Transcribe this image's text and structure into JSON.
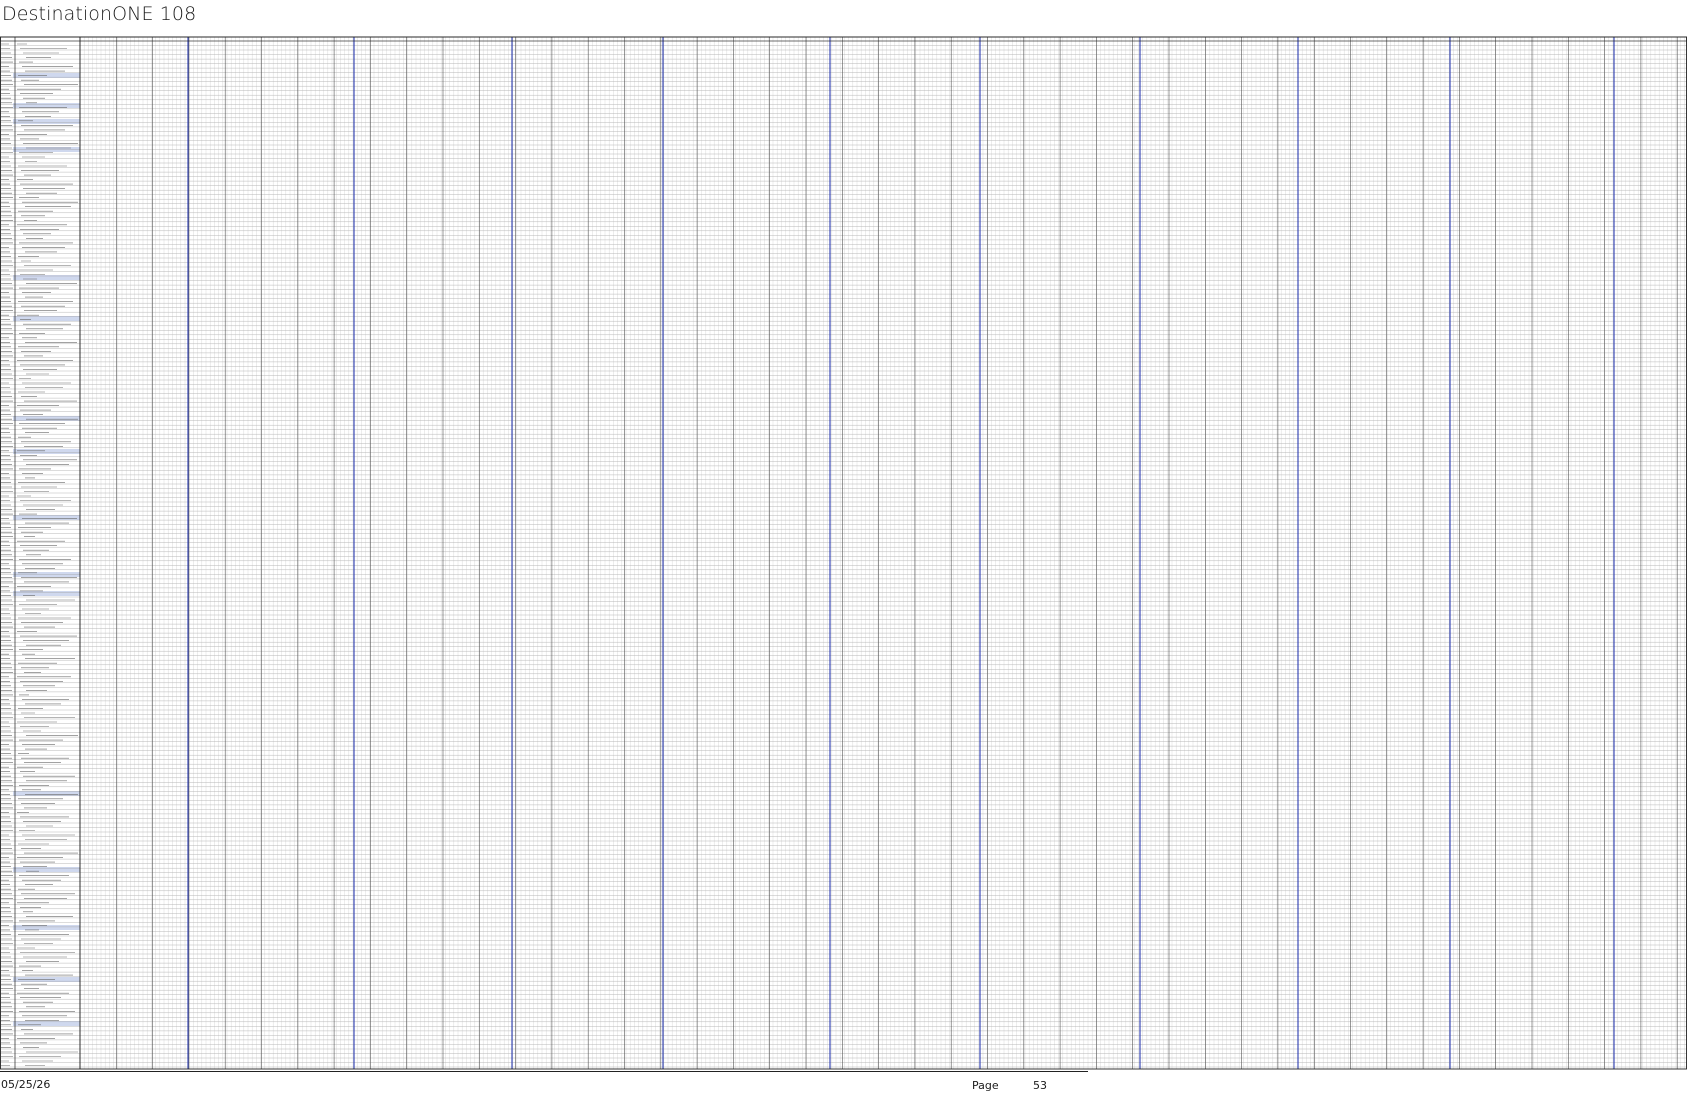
{
  "document": {
    "title": "DestinationONE 108"
  },
  "footer": {
    "date": "05/25/26",
    "page_label": "Page",
    "page_number": "53"
  },
  "colors": {
    "text": "#1a1a1a",
    "grid_line": "#9a9a9a",
    "divider_blue": "#2a3bb0",
    "row_highlight": "#cfd8ee",
    "frame": "#222222"
  }
}
